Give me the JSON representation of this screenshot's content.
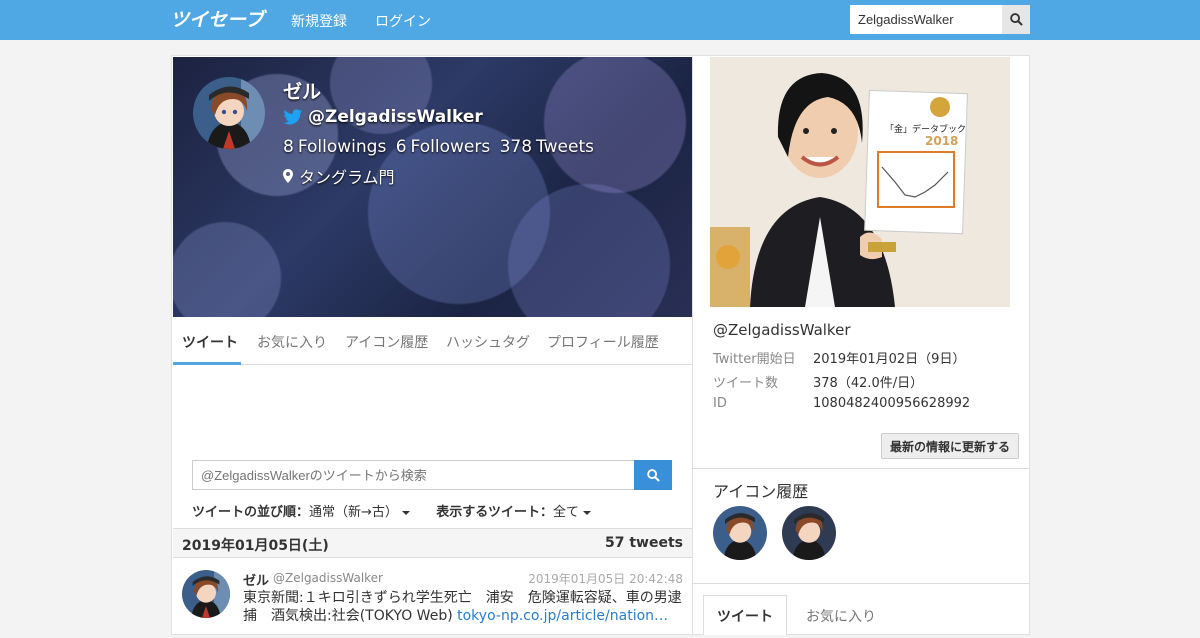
{
  "navbar": {
    "logo_text": "ツイセーブ",
    "register": "新規登録",
    "login": "ログイン",
    "search_value": "ZelgadissWalker",
    "accent_color": "#4fa8e4"
  },
  "profile": {
    "name": "ゼル",
    "handle": "@ZelgadissWalker",
    "followings_count": "8",
    "followings_label": "Followings",
    "followers_count": "6",
    "followers_label": "Followers",
    "tweets_count": "378",
    "tweets_label": "Tweets",
    "location": "タングラム門"
  },
  "tabs": [
    "ツイート",
    "お気に入り",
    "アイコン履歴",
    "ハッシュタグ",
    "プロフィール履歴"
  ],
  "tweet_search": {
    "placeholder": "@ZelgadissWalkerのツイートから検索"
  },
  "sort": {
    "order_label": "ツイートの並び順：",
    "order_value": "通常（新→古）",
    "filter_label": "表示するツイート：",
    "filter_value": "全て"
  },
  "date_group": {
    "date": "2019年01月05日(土)",
    "count": "57 tweets"
  },
  "tweet": {
    "name": "ゼル",
    "handle": "@ZelgadissWalker",
    "time": "2019年01月05日 20:42:48",
    "text": "東京新聞:１キロ引きずられ学生死亡　浦安　危険運転容疑、車の男逮捕　酒気検出:社会(TOKYO Web) ",
    "link": "tokyo-np.co.jp/article/nation…"
  },
  "ad": {
    "book_title": "「金」データブック",
    "book_year": "2018"
  },
  "account_info": {
    "handle": "@ZelgadissWalker",
    "rows": [
      {
        "label": "Twitter開始日",
        "value": "2019年01月02日（9日）"
      },
      {
        "label": "ツイート数",
        "value": "378（42.0件/日）"
      },
      {
        "label": "ID",
        "value": "1080482400956628992"
      }
    ],
    "update_button": "最新の情報に更新する"
  },
  "icon_history": {
    "title": "アイコン履歴"
  },
  "right_tabs": [
    "ツイート",
    "お気に入り"
  ]
}
